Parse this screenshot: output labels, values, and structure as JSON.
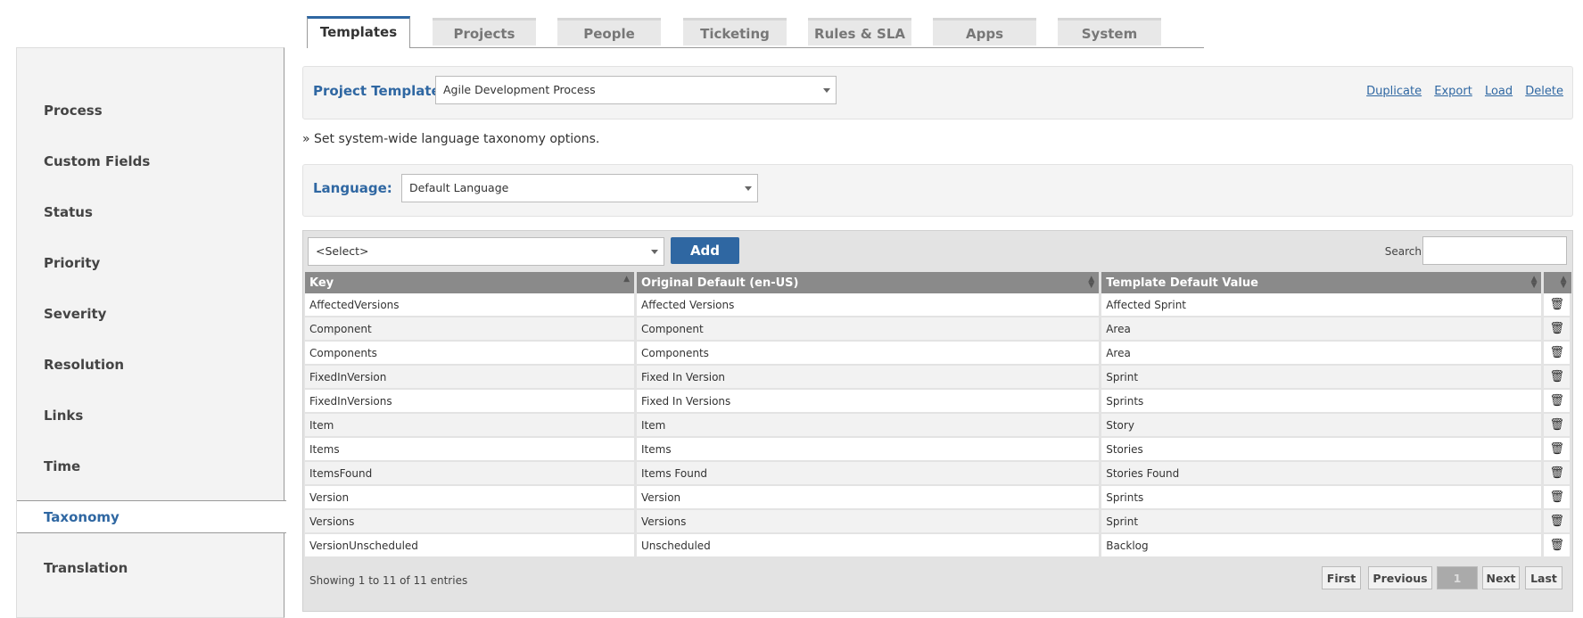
{
  "tabs": [
    "Templates",
    "Projects",
    "People",
    "Ticketing",
    "Rules & SLA",
    "Apps",
    "System"
  ],
  "sidebar": {
    "items": [
      "Process",
      "Custom Fields",
      "Status",
      "Priority",
      "Severity",
      "Resolution",
      "Links",
      "Time",
      "Taxonomy",
      "Translation"
    ],
    "active": "Taxonomy"
  },
  "template": {
    "label": "Project Template:",
    "value": "Agile Development Process",
    "actions": [
      "Duplicate",
      "Export",
      "Load",
      "Delete"
    ]
  },
  "hint": "» Set system-wide language taxonomy options.",
  "language": {
    "label": "Language:",
    "value": "Default Language"
  },
  "toolbar": {
    "select_value": "<Select>",
    "add_label": "Add",
    "search_label": "Search:"
  },
  "table": {
    "headers": [
      "Key",
      "Original Default (en-US)",
      "Template Default Value"
    ],
    "rows": [
      [
        "AffectedVersions",
        "Affected Versions",
        "Affected Sprint"
      ],
      [
        "Component",
        "Component",
        "Area"
      ],
      [
        "Components",
        "Components",
        "Area"
      ],
      [
        "FixedInVersion",
        "Fixed In Version",
        "Sprint"
      ],
      [
        "FixedInVersions",
        "Fixed In Versions",
        "Sprints"
      ],
      [
        "Item",
        "Item",
        "Story"
      ],
      [
        "Items",
        "Items",
        "Stories"
      ],
      [
        "ItemsFound",
        "Items Found",
        "Stories Found"
      ],
      [
        "Version",
        "Version",
        "Sprints"
      ],
      [
        "Versions",
        "Versions",
        "Sprint"
      ],
      [
        "VersionUnscheduled",
        "Unscheduled",
        "Backlog"
      ]
    ]
  },
  "footer": {
    "info": "Showing 1 to 11 of 11 entries",
    "pager": {
      "first": "First",
      "previous": "Previous",
      "current": "1",
      "next": "Next",
      "last": "Last"
    }
  }
}
